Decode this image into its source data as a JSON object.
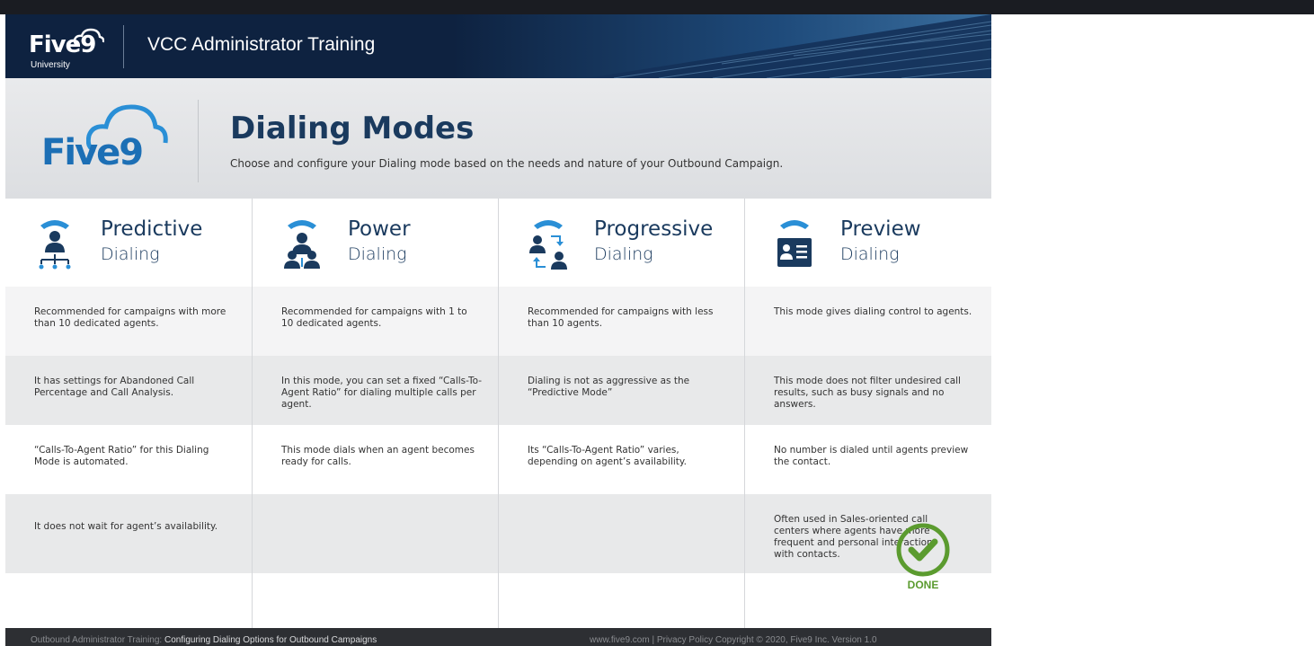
{
  "header": {
    "logo_word": "Five9",
    "logo_sub": "University",
    "title": "VCC Administrator Training"
  },
  "intro": {
    "logo_word": "Five9",
    "title": "Dialing Modes",
    "subtitle": "Choose and configure your Dialing mode based on the needs and nature of your Outbound Campaign."
  },
  "columns": [
    {
      "name": "Predictive",
      "sub": "Dialing",
      "icon": "predictive-dialing-icon",
      "rows": [
        "Recommended for campaigns with more than 10 dedicated agents.",
        "It has settings for Abandoned Call Percentage and Call Analysis.",
        "“Calls-To-Agent Ratio” for this Dialing Mode is automated.",
        "It does not wait for agent’s availability.",
        ""
      ]
    },
    {
      "name": "Power",
      "sub": "Dialing",
      "icon": "power-dialing-icon",
      "rows": [
        "Recommended for campaigns with 1 to 10 dedicated agents.",
        "In this mode, you can set a fixed “Calls-To-Agent Ratio” for dialing multiple calls per agent.",
        "This mode dials when an agent becomes ready for calls.",
        "",
        ""
      ]
    },
    {
      "name": "Progressive",
      "sub": "Dialing",
      "icon": "progressive-dialing-icon",
      "rows": [
        "Recommended for campaigns with less than 10 agents.",
        "Dialing is not as aggressive as the “Predictive Mode”",
        "Its “Calls-To-Agent Ratio” varies, depending on agent’s availability.",
        "",
        ""
      ]
    },
    {
      "name": "Preview",
      "sub": "Dialing",
      "icon": "preview-dialing-icon",
      "rows": [
        "This mode gives dialing control to agents.",
        "This mode does not filter undesired call results, such as busy signals and no answers.",
        "No number is dialed until agents preview the contact.",
        "Often used in Sales-oriented call centers where agents have more frequent and personal interaction with contacts.",
        ""
      ]
    }
  ],
  "done": {
    "label": "DONE",
    "icon": "checkmark-circle-icon"
  },
  "footer": {
    "left_prefix": "Outbound Administrator Training:",
    "left_course": "Configuring Dialing Options for Outbound Campaigns",
    "right": "www.five9.com  |  Privacy Policy     Copyright © 2020, Five9 Inc.   Version 1.0"
  },
  "colors": {
    "header_bg": "#0e2240",
    "title_blue": "#1a3a5e",
    "done_green": "#5b9b2f",
    "brand_blue": "#1c6fb5"
  }
}
